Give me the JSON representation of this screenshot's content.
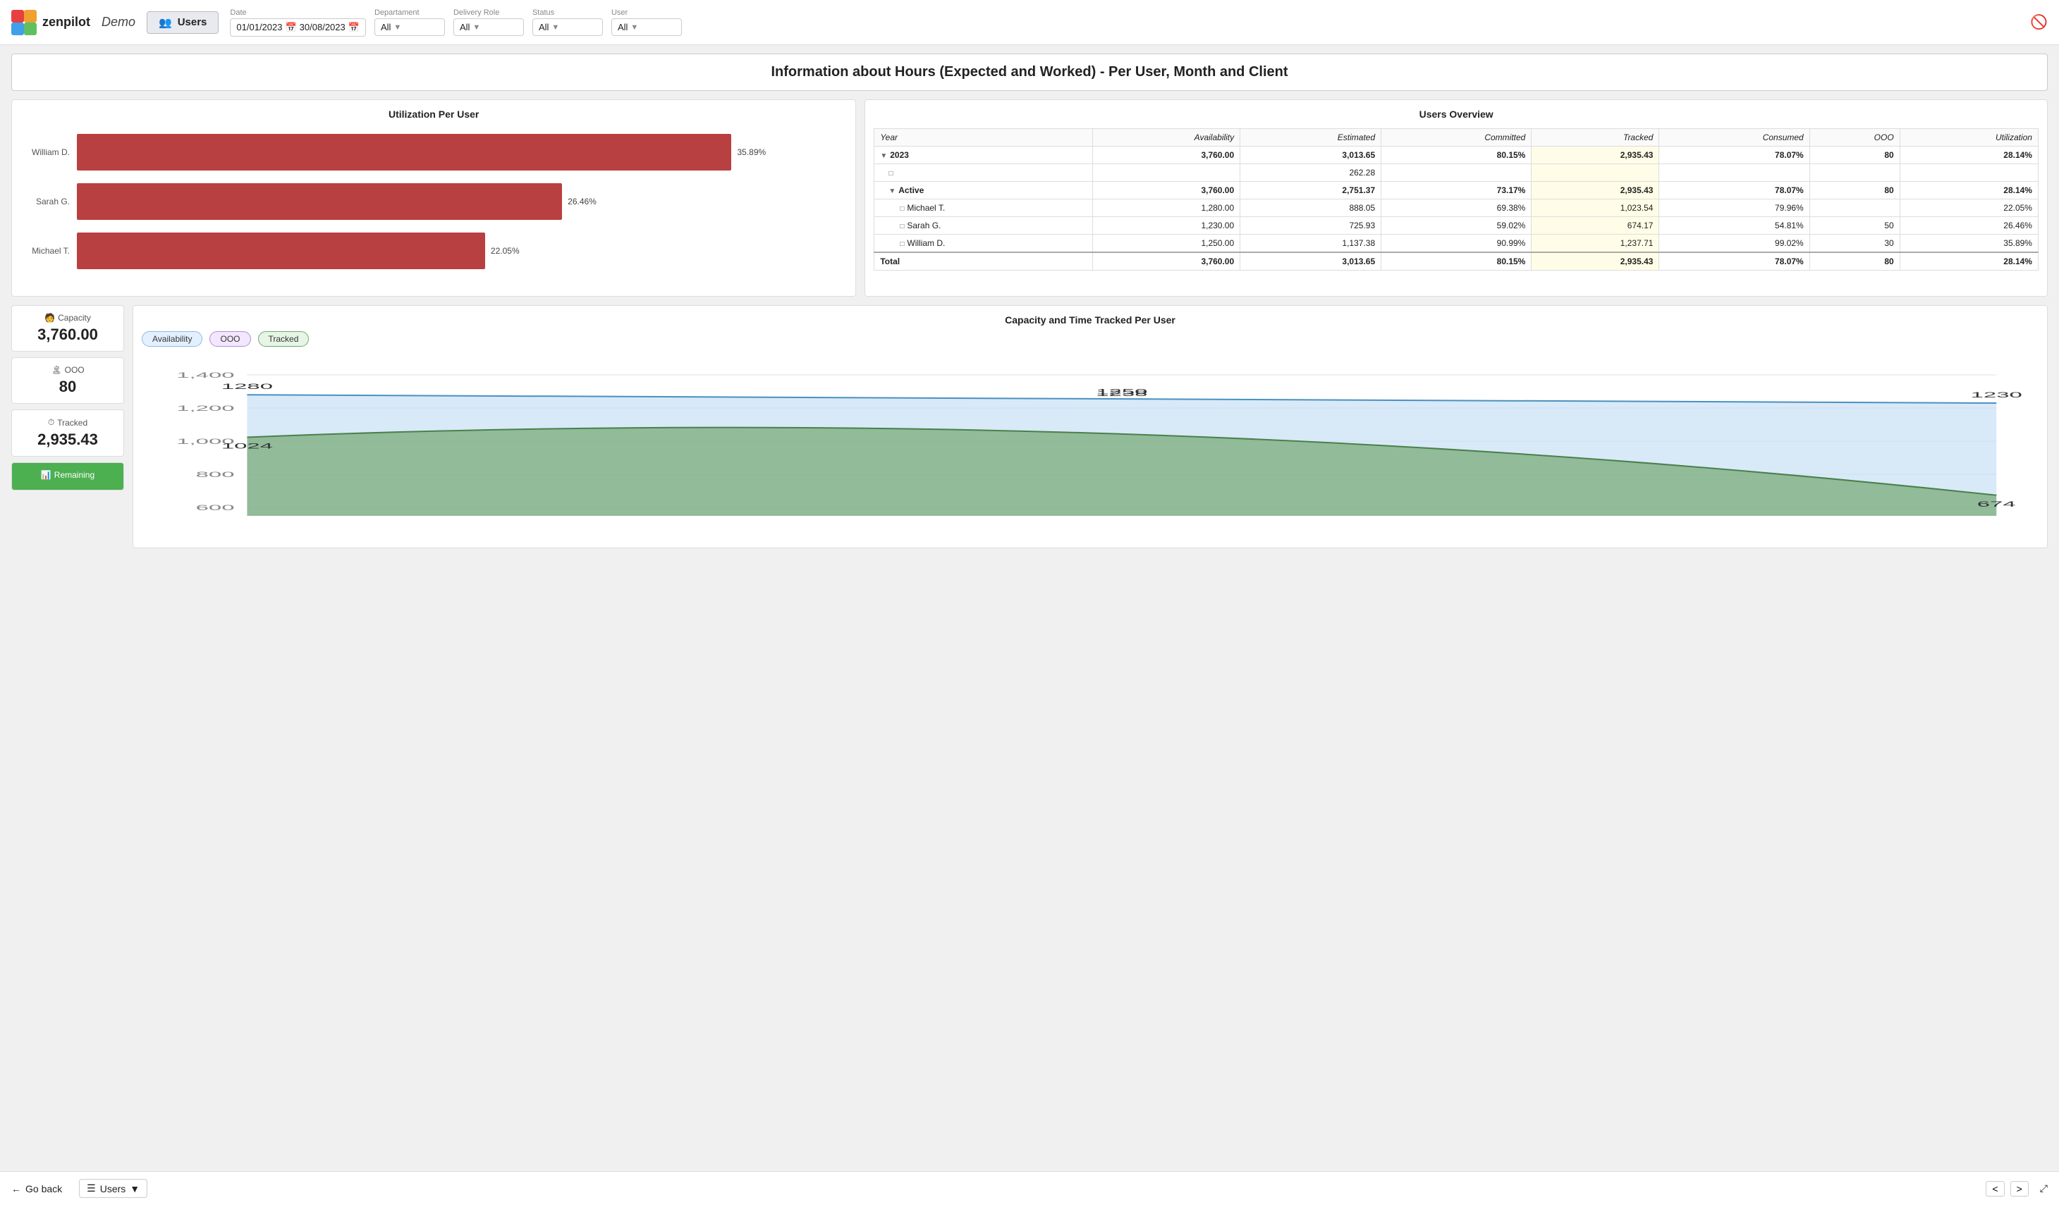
{
  "header": {
    "logo_text": "zenpilot",
    "demo_label": "Demo",
    "nav_users_label": "Users",
    "funnel_icon": "⊘",
    "filters": {
      "date_label": "Date",
      "date_from": "01/01/2023",
      "date_to": "30/08/2023",
      "department_label": "Departament",
      "department_value": "All",
      "delivery_role_label": "Delivery Role",
      "delivery_role_value": "All",
      "status_label": "Status",
      "status_value": "All",
      "user_label": "User",
      "user_value": "All"
    }
  },
  "page_title": "Information about Hours (Expected and Worked) - Per User, Month and Client",
  "utilization_chart": {
    "title": "Utilization Per User",
    "bars": [
      {
        "label": "William D.",
        "value": 35.89,
        "pct": "35.89%",
        "width_pct": 85
      },
      {
        "label": "Sarah G.",
        "value": 26.46,
        "pct": "26.46%",
        "width_pct": 63
      },
      {
        "label": "Michael T.",
        "value": 22.05,
        "pct": "22.05%",
        "width_pct": 53
      }
    ]
  },
  "users_overview": {
    "title": "Users Overview",
    "columns": [
      "Year",
      "Availability",
      "Estimated",
      "Committed",
      "Tracked",
      "Consumed",
      "OOO",
      "Utilization"
    ],
    "rows": [
      {
        "type": "year",
        "indent": 0,
        "year": "2023",
        "availability": "3,760.00",
        "estimated": "3,013.65",
        "committed": "80.15%",
        "tracked": "2,935.43",
        "consumed": "78.07%",
        "ooo": "80",
        "utilization": "28.14%",
        "toggle": "▼"
      },
      {
        "type": "estimated_sub",
        "indent": 1,
        "year": "",
        "availability": "",
        "estimated": "262.28",
        "committed": "",
        "tracked": "",
        "consumed": "",
        "ooo": "",
        "utilization": "",
        "toggle": "□"
      },
      {
        "type": "active",
        "indent": 1,
        "year": "Active",
        "availability": "3,760.00",
        "estimated": "2,751.37",
        "committed": "73.17%",
        "tracked": "2,935.43",
        "consumed": "78.07%",
        "ooo": "80",
        "utilization": "28.14%",
        "toggle": "▼"
      },
      {
        "type": "user",
        "indent": 2,
        "year": "Michael T.",
        "availability": "1,280.00",
        "estimated": "888.05",
        "committed": "69.38%",
        "tracked": "1,023.54",
        "consumed": "79.96%",
        "ooo": "",
        "utilization": "22.05%",
        "toggle": "□"
      },
      {
        "type": "user",
        "indent": 2,
        "year": "Sarah G.",
        "availability": "1,230.00",
        "estimated": "725.93",
        "committed": "59.02%",
        "tracked": "674.17",
        "consumed": "54.81%",
        "ooo": "50",
        "utilization": "26.46%",
        "toggle": "□"
      },
      {
        "type": "user",
        "indent": 2,
        "year": "William D.",
        "availability": "1,250.00",
        "estimated": "1,137.38",
        "committed": "90.99%",
        "tracked": "1,237.71",
        "consumed": "99.02%",
        "ooo": "30",
        "utilization": "35.89%",
        "toggle": "□"
      },
      {
        "type": "total",
        "indent": 0,
        "year": "Total",
        "availability": "3,760.00",
        "estimated": "3,013.65",
        "committed": "80.15%",
        "tracked": "2,935.43",
        "consumed": "78.07%",
        "ooo": "80",
        "utilization": "28.14%",
        "toggle": ""
      }
    ]
  },
  "stats": [
    {
      "icon": "🧑",
      "label": "Capacity",
      "value": "3,760.00",
      "type": "normal"
    },
    {
      "icon": "🏝",
      "label": "OOO",
      "value": "80",
      "type": "normal"
    },
    {
      "icon": "⏱",
      "label": "Tracked",
      "value": "2,935.43",
      "type": "normal"
    },
    {
      "icon": "📊",
      "label": "Remaining",
      "value": "",
      "type": "remaining"
    }
  ],
  "capacity_chart": {
    "title": "Capacity and Time Tracked Per User",
    "legend": [
      {
        "key": "availability",
        "label": "Availability",
        "class": "availability"
      },
      {
        "key": "ooo",
        "label": "OOO",
        "class": "ooo"
      },
      {
        "key": "tracked",
        "label": "Tracked",
        "class": "tracked"
      }
    ],
    "y_labels": [
      "1,400",
      "1,200",
      "1,000",
      "800",
      "600"
    ],
    "data_points": [
      {
        "x": 0,
        "availability": 1280,
        "tracked": 1024,
        "label_a": "1280",
        "label_t": "1024"
      },
      {
        "x": 0.5,
        "availability": 1250,
        "tracked": 1238,
        "label_a": "1250",
        "label_t": "1238"
      },
      {
        "x": 1,
        "availability": 1230,
        "tracked": 674,
        "label_a": "1230",
        "label_t": "674"
      }
    ]
  },
  "footer": {
    "back_label": "Go back",
    "users_label": "Users",
    "prev_icon": "<",
    "next_icon": ">",
    "expand_icon": "⤢"
  }
}
